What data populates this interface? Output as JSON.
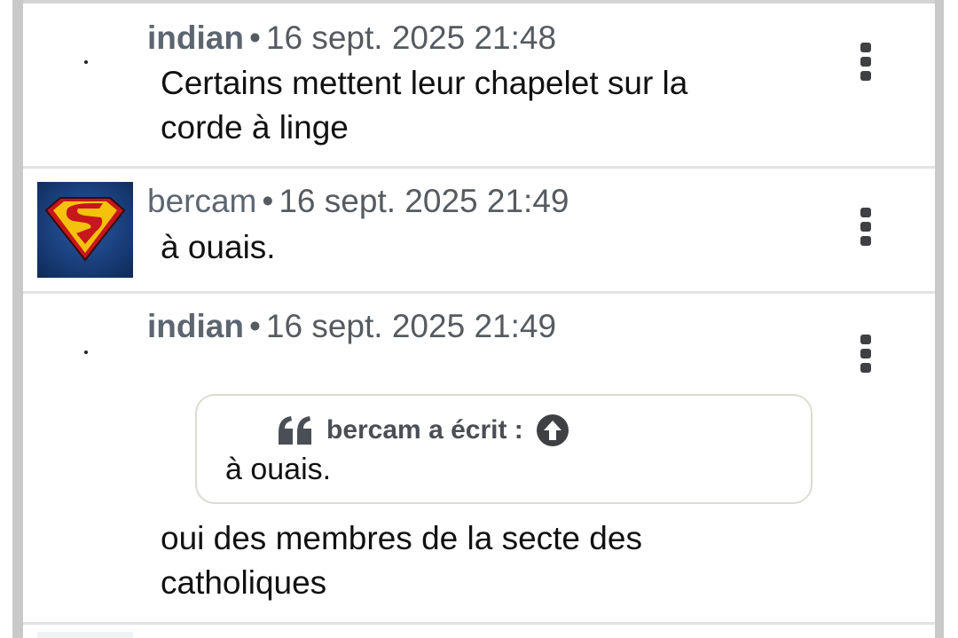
{
  "posts": [
    {
      "author": "indian",
      "separator": "•",
      "date": "16 sept. 2025 21:48",
      "lines": [
        "Certains mettent leur chapelet sur la",
        "corde à linge"
      ],
      "avatar": "dot",
      "menu_icon": "kebab-menu-icon"
    },
    {
      "author": "bercam",
      "separator": "•",
      "date": "16 sept. 2025 21:49",
      "lines": [
        "à ouais."
      ],
      "avatar": "superman-logo",
      "menu_icon": "kebab-menu-icon"
    },
    {
      "author": "indian",
      "separator": "•",
      "date": "16 sept. 2025 21:49",
      "quote": {
        "header": "bercam a écrit :",
        "text": "à ouais.",
        "quote_icon": "quote-marks-icon",
        "goto_icon": "arrow-up-circle-icon"
      },
      "lines": [
        "oui des membres de la secte des",
        "catholiques"
      ],
      "avatar": "dot",
      "menu_icon": "kebab-menu-icon"
    }
  ],
  "colors": {
    "author": "#5c6670",
    "meta": "#555b60",
    "body": "#111111",
    "rail": "#c9c9c9",
    "divider": "#e2e2e2",
    "quote_border": "#dcdcd0",
    "icon": "#3e4044"
  }
}
